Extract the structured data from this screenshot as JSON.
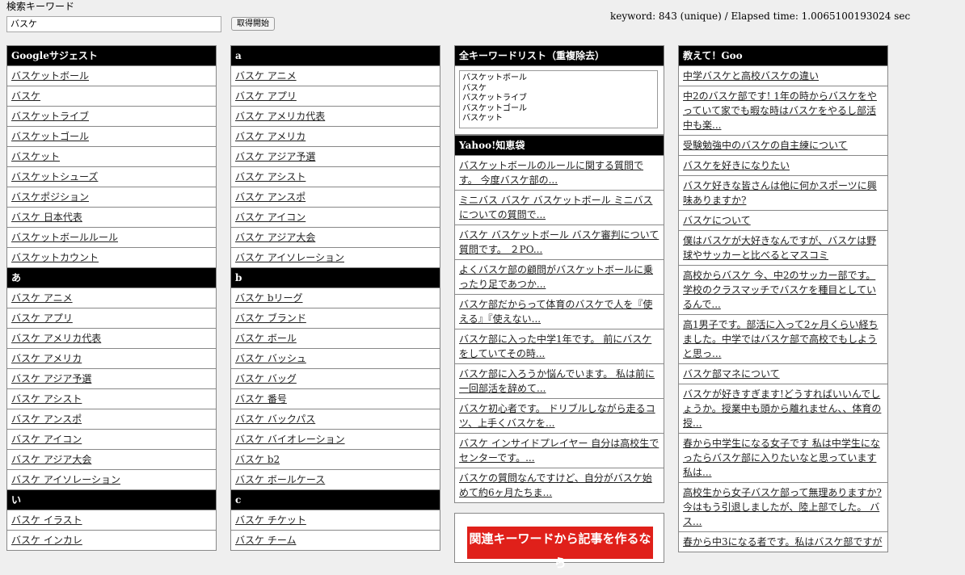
{
  "search": {
    "label": "検索キーワード",
    "value": "バスケ",
    "button": "取得開始"
  },
  "stats": {
    "text": "keyword: 843 (unique) / Elapsed time: 1.0065100193024 sec"
  },
  "col1": {
    "sections": [
      {
        "title": "Googleサジェスト",
        "items": [
          "バスケットボール",
          "バスケ",
          "バスケットライブ",
          "バスケットゴール",
          "バスケット",
          "バスケットシューズ",
          "バスケポジション",
          "バスケ 日本代表",
          "バスケットボールルール",
          "バスケットカウント"
        ]
      },
      {
        "title": "あ",
        "items": [
          "バスケ アニメ",
          "バスケ アプリ",
          "バスケ アメリカ代表",
          "バスケ アメリカ",
          "バスケ アジア予選",
          "バスケ アシスト",
          "バスケ アンスポ",
          "バスケ アイコン",
          "バスケ アジア大会",
          "バスケ アイソレーション"
        ]
      },
      {
        "title": "い",
        "items": [
          "バスケ イラスト",
          "バスケ インカレ"
        ]
      }
    ]
  },
  "col2": {
    "sections": [
      {
        "title": "a",
        "items": [
          "バスケ アニメ",
          "バスケ アプリ",
          "バスケ アメリカ代表",
          "バスケ アメリカ",
          "バスケ アジア予選",
          "バスケ アシスト",
          "バスケ アンスポ",
          "バスケ アイコン",
          "バスケ アジア大会",
          "バスケ アイソレーション"
        ]
      },
      {
        "title": "b",
        "items": [
          "バスケ bリーグ",
          "バスケ ブランド",
          "バスケ ボール",
          "バスケ バッシュ",
          "バスケ バッグ",
          "バスケ 番号",
          "バスケ バックパス",
          "バスケ バイオレーション",
          "バスケ b2",
          "バスケ ボールケース"
        ]
      },
      {
        "title": "c",
        "items": [
          "バスケ チケット",
          "バスケ チーム"
        ]
      }
    ]
  },
  "col3": {
    "all_title": "全キーワードリスト（重複除去）",
    "all_keywords": "バスケットボール\nバスケ\nバスケットライブ\nバスケットゴール\nバスケット",
    "yahoo_title": "Yahoo!知恵袋",
    "yahoo_items": [
      "バスケットボールのルールに関する質問です。 今度バスケ部の...",
      "ミニバス バスケ バスケットボール ミニバスについての質問で...",
      "バスケ バスケットボール バスケ審判について質問です。 ２PO...",
      "よくバスケ部の顧問がバスケットボールに乗ったり足であつか...",
      "バスケ部だからって体育のバスケで人を『使える』『使えない...",
      "バスケ部に入った中学1年です。 前にバスケをしていてその時...",
      "バスケ部に入ろうか悩んでいます。 私は前に一回部活を辞めて...",
      "バスケ初心者です。 ドリブルしながら走るコツ、上手くバスケを...",
      "バスケ インサイドプレイヤー 自分は高校生でセンターです。...",
      "バスケの質問なんですけど、自分がバスケ始めて約6ヶ月たちま..."
    ],
    "ad_text": "関連キーワードから記事を作るなら"
  },
  "col4": {
    "title": "教えて！Goo",
    "items": [
      "中学バスケと高校バスケの違い",
      "中2のバスケ部です! 1年の時からバスケをやっていて家でも暇な時はバスケをやるし部活中も楽...",
      "受験勉強中のバスケの自主練について",
      "バスケを好きになりたい",
      "バスケ好きな皆さんは他に何かスポーツに興味ありますか?",
      "バスケについて",
      "僕はバスケが大好きなんですが、バスケは野球やサッカーと比べるとマスコミ",
      "高校からバスケ 今、中2のサッカー部です。学校のクラスマッチでバスケを種目としているんで...",
      "高1男子です。部活に入って2ヶ月くらい経ちました。中学ではバスケ部で高校でもしようと思っ...",
      "バスケ部マネについて",
      "バスケが好きすぎます!どうすればいいんでしょうか。授業中も頭から離れません、、体育の授...",
      "春から中学生になる女子です 私は中学生になったらバスケ部に入りたいなと思っています 私は...",
      "高校生から女子バスケ部って無理ありますか? 今はもう引退しましたが、陸上部でした。 バス...",
      "春から中3になる者です。私はバスケ部ですが"
    ]
  }
}
